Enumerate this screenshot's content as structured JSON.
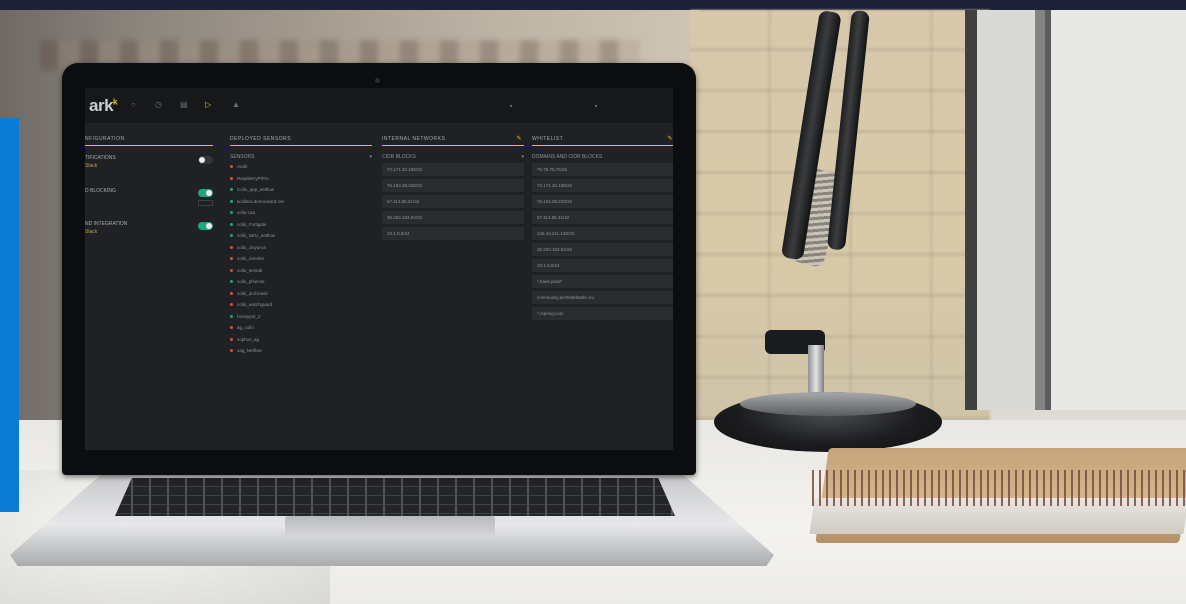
{
  "app": {
    "logo_text": "ark",
    "logo_sup": "k",
    "nav_icons": [
      "home-icon",
      "clock-icon",
      "list-icon",
      "folder-icon",
      "trash-icon"
    ],
    "header_right": [
      "",
      ""
    ]
  },
  "config": {
    "title": "NFIGURATION",
    "rows": [
      {
        "label": "TIFICATIONS",
        "sub": "Slack",
        "toggle": "off"
      },
      {
        "label": "D BLOCKING",
        "sub": "",
        "toggle": "on"
      },
      {
        "label": "ND INTEGRATION",
        "sub": "Slack",
        "toggle": "on"
      }
    ]
  },
  "sensors": {
    "title": "DEPLOYED SENSORS",
    "subheader": "SENSORS",
    "items": [
      {
        "name": "Audit",
        "color": "#d84a4a"
      },
      {
        "name": "RaspberryPiPro",
        "color": "#d84a4a"
      },
      {
        "name": "Collo_app_netflow",
        "color": "#1fa77c"
      },
      {
        "name": "kcollara.demoukard.net",
        "color": "#1fa77c"
      },
      {
        "name": "collo-caq",
        "color": "#1fa77c"
      },
      {
        "name": "collo_Fortigate",
        "color": "#1fa77c"
      },
      {
        "name": "collo_NEU_netflow",
        "color": "#1fa77c"
      },
      {
        "name": "collo_cloyuncs",
        "color": "#d84a4a"
      },
      {
        "name": "collo_rarester",
        "color": "#d84a4a"
      },
      {
        "name": "collo_snmab",
        "color": "#d84a4a"
      },
      {
        "name": "collo_pfsense",
        "color": "#1fa77c"
      },
      {
        "name": "collo_archivasil",
        "color": "#d84a4a"
      },
      {
        "name": "collo_watchguard",
        "color": "#d84a4a"
      },
      {
        "name": "honeypot_2",
        "color": "#1fa77c"
      },
      {
        "name": "ag_collo",
        "color": "#d84a4a"
      },
      {
        "name": "sophos_ag",
        "color": "#d84a4a"
      },
      {
        "name": "xag_Netflow",
        "color": "#d84a4a"
      }
    ]
  },
  "internal": {
    "title": "INTERNAL NETWORKS",
    "subheader": "CIDR BLOCKS",
    "items": [
      "72.171.32.198/32",
      "76.193.38.220/32",
      "57.114.85.31/32",
      "35.202.163.94/32",
      "10.1.0.0/24"
    ]
  },
  "whitelist": {
    "title": "WHITELIST",
    "subheader": "DOMAINS AND CIDR BLOCKS",
    "items": [
      "75.75.75.75/32",
      "72.171.32.198/32",
      "76.194.38.220/32",
      "57.114.88.31/32",
      "146.44.211.136/32",
      "35.202.163.94/32",
      "10.1.0.0/24",
      "*.bank.plaid*",
      "community.archeitektathc.eu",
      "*.rspring.com"
    ]
  }
}
